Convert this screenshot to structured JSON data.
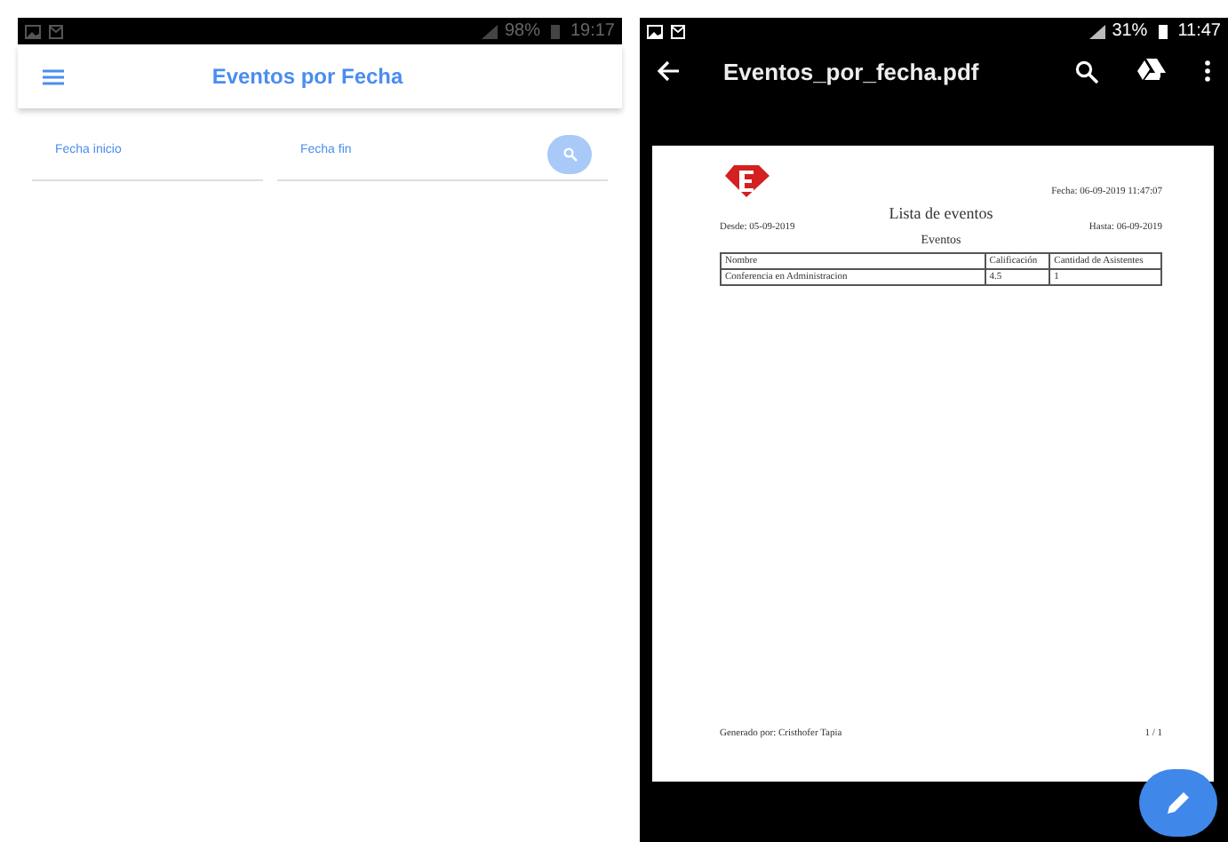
{
  "left_screen": {
    "status_bar": {
      "battery": "98%",
      "time": "19:17"
    },
    "app_bar": {
      "title": "Eventos por Fecha"
    },
    "fields": [
      {
        "label": "Fecha inicio"
      },
      {
        "label": "Fecha fin"
      }
    ]
  },
  "right_screen": {
    "status_bar": {
      "battery": "31%",
      "time": "11:47"
    },
    "toolbar": {
      "title": "Eventos_por_fecha.pdf"
    },
    "document": {
      "date_stamp": "Fecha: 06-09-2019 11:47:07",
      "title": "Lista de eventos",
      "from": "Desde: 05-09-2019",
      "to": "Hasta: 06-09-2019",
      "section": "Eventos",
      "table": {
        "columns": [
          "Nombre",
          "Calificación",
          "Cantidad de Asistentes"
        ],
        "rows": [
          [
            "Conferencia en Administracion",
            "4.5",
            "1"
          ]
        ]
      },
      "footer": "Generado por: Cristhofer Tapia",
      "page": "1 / 1"
    }
  }
}
